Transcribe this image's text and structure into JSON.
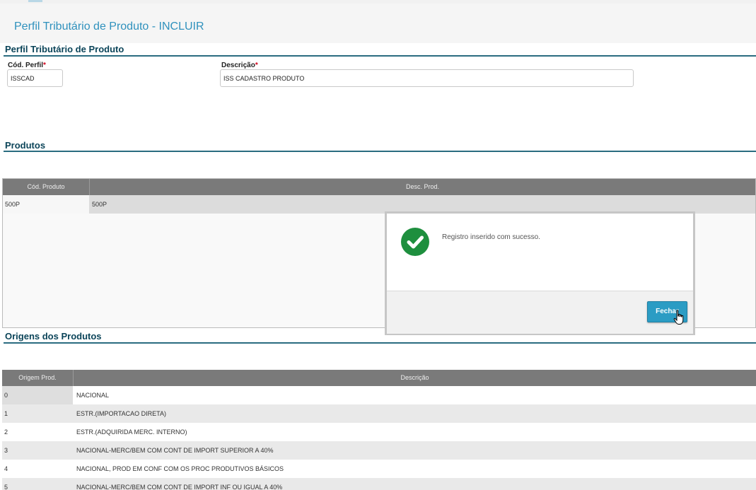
{
  "page": {
    "title": "Perfil Tributário de Produto - INCLUIR"
  },
  "section_perfil": {
    "title": "Perfil Tributário de Produto",
    "cod_label": "Cód. Perfil",
    "cod_value": "ISSCAD",
    "desc_label": "Descrição",
    "desc_value": "ISS CADASTRO PRODUTO",
    "required_mark": "*"
  },
  "section_produtos": {
    "title": "Produtos",
    "columns": [
      "Cód. Produto",
      "Desc. Prod."
    ],
    "rows": [
      {
        "cod": "500P",
        "desc": "500P"
      }
    ]
  },
  "modal": {
    "message": "Registro inserido com sucesso.",
    "close_label": "Fechar"
  },
  "section_origens": {
    "title": "Origens dos Produtos",
    "columns": [
      "Origem Prod.",
      "Descrição"
    ],
    "rows": [
      {
        "orig": "0",
        "desc": "NACIONAL"
      },
      {
        "orig": "1",
        "desc": "ESTR.(IMPORTACAO DIRETA)"
      },
      {
        "orig": "2",
        "desc": "ESTR.(ADQUIRIDA MERC. INTERNO)"
      },
      {
        "orig": "3",
        "desc": "NACIONAL-MERC/BEM COM CONT DE IMPORT SUPERIOR A 40%"
      },
      {
        "orig": "4",
        "desc": "NACIONAL, PROD EM CONF COM OS PROC PRODUTIVOS BÁSICOS"
      },
      {
        "orig": "5",
        "desc": "NACIONAL-MERC/BEM COM CONT DE IMPORT INF OU IGUAL A 40%"
      }
    ]
  },
  "colors": {
    "accent": "#2f91bd",
    "section_title": "#0b4459",
    "success": "#1e8f3e",
    "button": "#2b9cc4",
    "grid_header": "#7a7a7a"
  }
}
